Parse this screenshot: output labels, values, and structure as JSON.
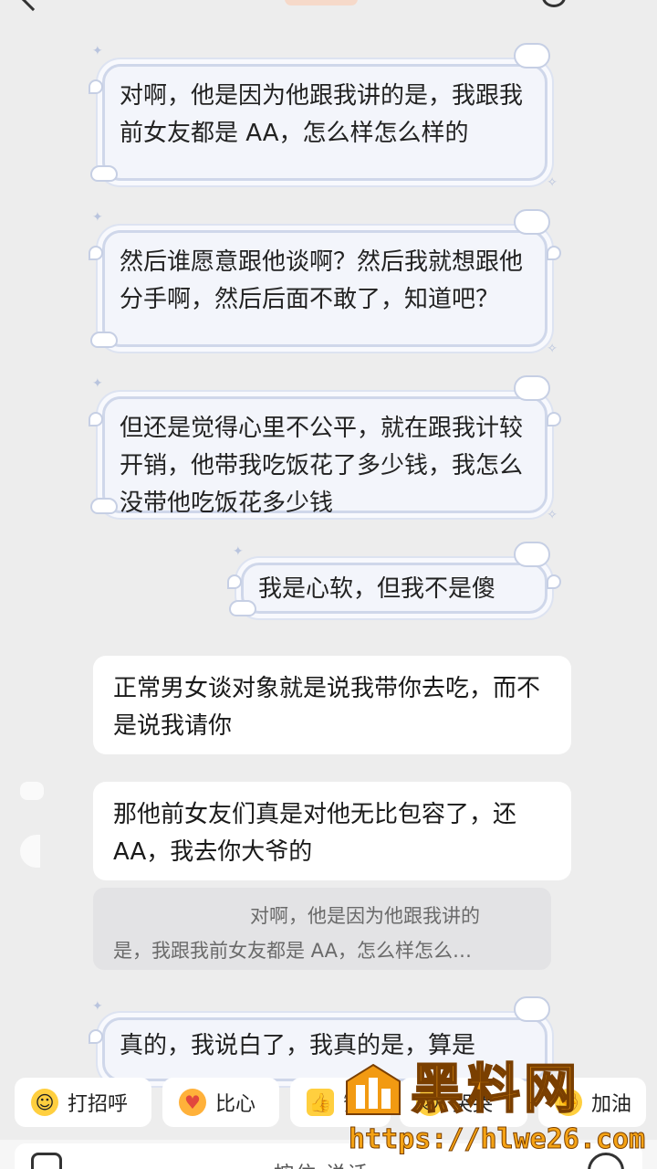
{
  "header": {
    "back_icon": "chevron-left-icon",
    "right_icon": "phone-icon"
  },
  "messages": [
    {
      "type": "sticker-bubble",
      "side": "right",
      "text": "对啊，他是因为他跟我讲的是，我跟我前女友都是 AA，怎么样怎么样的"
    },
    {
      "type": "sticker-bubble",
      "side": "right",
      "text": "然后谁愿意跟他谈啊？然后我就想跟他分手啊，然后后面不敢了，知道吧？"
    },
    {
      "type": "sticker-bubble",
      "side": "right",
      "text": "但还是觉得心里不公平，就在跟我计较开销，他带我吃饭花了多少钱，我怎么没带他吃饭花多少钱"
    },
    {
      "type": "sticker-bubble",
      "side": "right",
      "text": "我是心软，但我不是傻"
    },
    {
      "type": "bubble",
      "side": "left",
      "text": "正常男女谈对象就是说我带你去吃，而不是说我请你"
    },
    {
      "type": "bubble",
      "side": "left",
      "text": "那他前女友们真是对他无比包容了，还 AA，我去你大爷的"
    },
    {
      "type": "sticker-bubble",
      "side": "right",
      "text": "真的，我说白了，我真的是，算是"
    }
  ],
  "quote": {
    "line1": "对啊，他是因为他跟我讲的",
    "line2": "是，我跟我前女友都是 AA，怎么样怎么…"
  },
  "quick_replies": [
    {
      "label": "打招呼",
      "icon": "smile-emoji-icon"
    },
    {
      "label": "比心",
      "icon": "heart-hand-emoji-icon"
    },
    {
      "label": "赞",
      "icon": "thumbs-up-emoji-icon"
    },
    {
      "label": "哭哭",
      "icon": "crying-emoji-icon"
    },
    {
      "label": "加油",
      "icon": "cheer-emoji-icon"
    }
  ],
  "input": {
    "placeholder": "按住 说话",
    "left_icon": "camera-icon",
    "right_icon": "emoji-icon"
  },
  "watermark": {
    "title": "黑料网",
    "url": "https://hlwe26.com"
  }
}
